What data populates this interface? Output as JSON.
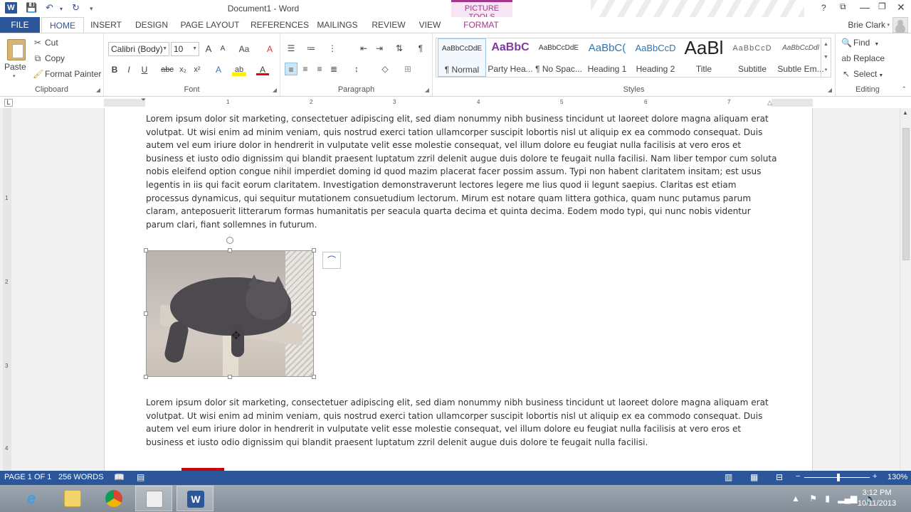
{
  "window": {
    "title": "Document1 - Word",
    "contextual_tab_group": "PICTURE TOOLS",
    "user": "Brie Clark",
    "help": "?",
    "controls": [
      "⧉",
      "—",
      "❐",
      "✕"
    ]
  },
  "quick_access": {
    "save": "💾",
    "undo": "↶",
    "redo": "↻",
    "customize": "▾"
  },
  "tabs": [
    "FILE",
    "HOME",
    "INSERT",
    "DESIGN",
    "PAGE LAYOUT",
    "REFERENCES",
    "MAILINGS",
    "REVIEW",
    "VIEW",
    "FORMAT"
  ],
  "ribbon": {
    "clipboard": {
      "label": "Clipboard",
      "paste": "Paste",
      "cut": "Cut",
      "copy": "Copy",
      "format_painter": "Format Painter"
    },
    "font": {
      "label": "Font",
      "font_name": "Calibri (Body)",
      "font_size": "10",
      "grow": "A",
      "shrink": "A",
      "case": "Aa",
      "clear": "A",
      "bold": "B",
      "italic": "I",
      "underline": "U",
      "strike": "abc",
      "subscript": "x₂",
      "superscript": "x²",
      "effects": "A",
      "highlight": "ab",
      "color": "A"
    },
    "paragraph": {
      "label": "Paragraph",
      "pilcrow": "¶"
    },
    "styles": {
      "label": "Styles",
      "items": [
        {
          "preview": "AaBbCcDdE",
          "name": "¶ Normal"
        },
        {
          "preview": "AaBbC",
          "name": "Party Hea..."
        },
        {
          "preview": "AaBbCcDdE",
          "name": "¶ No Spac..."
        },
        {
          "preview": "AaBbC(",
          "name": "Heading 1"
        },
        {
          "preview": "AaBbCcD",
          "name": "Heading 2"
        },
        {
          "preview": "AaBl",
          "name": "Title"
        },
        {
          "preview": "AaBbCcD",
          "name": "Subtitle"
        },
        {
          "preview": "AaBbCcDdl",
          "name": "Subtle Em..."
        }
      ]
    },
    "editing": {
      "label": "Editing",
      "find": "Find",
      "replace": "Replace",
      "select": "Select"
    }
  },
  "ruler": {
    "marks": [
      "1",
      "2",
      "3",
      "4",
      "5",
      "6",
      "7"
    ],
    "vertical_marks": [
      "1",
      "2",
      "3",
      "4"
    ]
  },
  "document": {
    "paragraph_1": "Lorem ipsum dolor sit marketing, consectetuer adipiscing elit, sed diam nonummy nibh business tincidunt ut laoreet dolore magna aliquam erat volutpat. Ut wisi enim ad minim veniam, quis nostrud exerci tation ullamcorper suscipit lobortis nisl ut aliquip ex ea commodo consequat. Duis autem vel eum iriure dolor in hendrerit in vulputate velit esse molestie consequat, vel illum dolore eu feugiat nulla facilisis at vero eros et business et iusto odio dignissim qui blandit praesent luptatum zzril delenit augue duis dolore te feugait nulla facilisi. Nam liber tempor cum soluta nobis eleifend option congue nihil imperdiet doming id quod mazim placerat facer possim assum. Typi non habent claritatem insitam; est usus legentis in iis qui facit eorum claritatem. Investigation demonstraverunt lectores legere me lius quod ii legunt saepius. Claritas est etiam processus dynamicus, qui sequitur mutationem consuetudium lectorum. Mirum est notare quam littera gothica, quam nunc putamus parum claram, anteposuerit litterarum formas humanitatis per seacula quarta decima et quinta decima. Eodem modo typi, qui nunc nobis videntur parum clari, fiant sollemnes in futurum.",
    "paragraph_2": "Lorem ipsum dolor sit marketing, consectetuer adipiscing elit, sed diam nonummy nibh business tincidunt ut laoreet dolore magna aliquam erat volutpat. Ut wisi enim ad minim veniam, quis nostrud exerci tation ullamcorper suscipit lobortis nisl ut aliquip ex ea commodo consequat. Duis autem vel eum iriure dolor in hendrerit in vulputate velit esse molestie consequat, vel illum dolore eu feugiat nulla facilisis at vero eros et business et iusto odio dignissim qui blandit praesent luptatum zzril delenit augue duis dolore te feugait nulla facilisi."
  },
  "status": {
    "page": "PAGE 1 OF 1",
    "words": "256 WORDS",
    "zoom": "130%",
    "zoom_minus": "−",
    "zoom_plus": "+"
  },
  "taskbar": {
    "time": "3:12 PM",
    "date": "10/11/2013"
  },
  "colors": {
    "accent": "#2b579a",
    "picture_tools": "#a4378a"
  }
}
